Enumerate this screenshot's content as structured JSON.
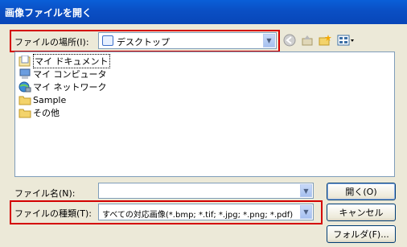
{
  "window": {
    "title": "画像ファイルを開く"
  },
  "location": {
    "label": "ファイルの場所(I):",
    "value": "デスクトップ"
  },
  "toolbar": {
    "icons": [
      "back-icon",
      "up-folder-icon",
      "new-folder-icon",
      "view-menu-icon"
    ]
  },
  "files": [
    {
      "name": "マイ ドキュメント",
      "icon": "my-documents-icon"
    },
    {
      "name": "マイ コンピュータ",
      "icon": "my-computer-icon"
    },
    {
      "name": "マイ ネットワーク",
      "icon": "my-network-icon"
    },
    {
      "name": "Sample",
      "icon": "folder-icon"
    },
    {
      "name": "その他",
      "icon": "folder-icon"
    }
  ],
  "filename": {
    "label": "ファイル名(N):",
    "value": ""
  },
  "filetype": {
    "label": "ファイルの種類(T):",
    "value": "すべての対応画像(*.bmp; *.tif; *.jpg; *.png; *.pdf)"
  },
  "buttons": {
    "open": "開く(O)",
    "cancel": "キャンセル",
    "folder": "フォルダ(F)..."
  },
  "colors": {
    "title_bar": "#0a4fc4",
    "highlight_box": "#d40000",
    "dialog_bg": "#ece9d8"
  }
}
